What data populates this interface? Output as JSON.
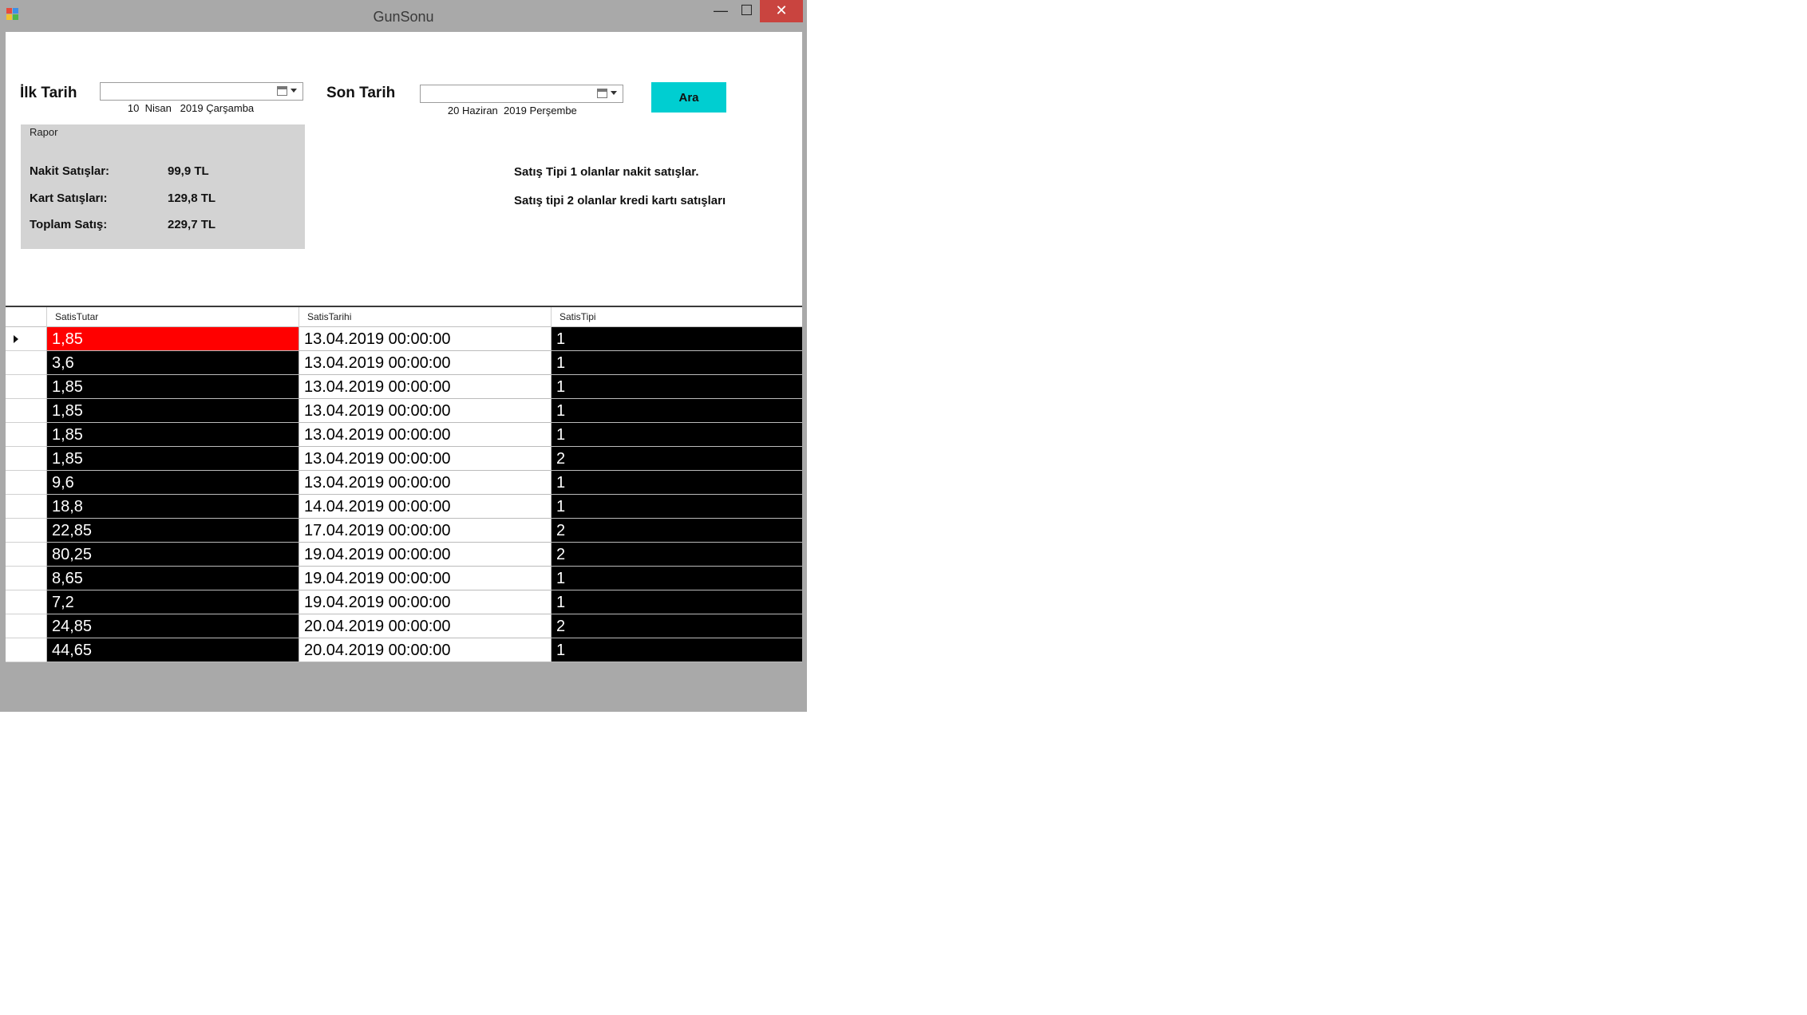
{
  "window": {
    "title": "GunSonu",
    "minimize": "—",
    "maximize": "☐",
    "close": "✕"
  },
  "filters": {
    "start_label": "İlk Tarih",
    "start_value": "10  Nisan   2019 Çarşamba",
    "end_label": "Son Tarih",
    "end_value": "20 Haziran  2019 Perşembe",
    "search_button": "Ara"
  },
  "report": {
    "legend": "Rapor",
    "rows": [
      {
        "label": "Nakit Satışlar:",
        "value": "99,9 TL"
      },
      {
        "label": "Kart Satışları:",
        "value": "129,8 TL"
      },
      {
        "label": "Toplam Satış:",
        "value": "229,7 TL"
      }
    ]
  },
  "notes": [
    "Satış Tipi 1 olanlar nakit satışlar.",
    "Satış tipi 2 olanlar kredi kartı satışları"
  ],
  "grid": {
    "columns": [
      "SatisTutar",
      "SatisTarihi",
      "SatisTipi"
    ],
    "rows": [
      [
        "1,85",
        "13.04.2019 00:00:00",
        "1"
      ],
      [
        "3,6",
        "13.04.2019 00:00:00",
        "1"
      ],
      [
        "1,85",
        "13.04.2019 00:00:00",
        "1"
      ],
      [
        "1,85",
        "13.04.2019 00:00:00",
        "1"
      ],
      [
        "1,85",
        "13.04.2019 00:00:00",
        "1"
      ],
      [
        "1,85",
        "13.04.2019 00:00:00",
        "2"
      ],
      [
        "9,6",
        "13.04.2019 00:00:00",
        "1"
      ],
      [
        "18,8",
        "14.04.2019 00:00:00",
        "1"
      ],
      [
        "22,85",
        "17.04.2019 00:00:00",
        "2"
      ],
      [
        "80,25",
        "19.04.2019 00:00:00",
        "2"
      ],
      [
        "8,65",
        "19.04.2019 00:00:00",
        "1"
      ],
      [
        "7,2",
        "19.04.2019 00:00:00",
        "1"
      ],
      [
        "24,85",
        "20.04.2019 00:00:00",
        "2"
      ],
      [
        "44,65",
        "20.04.2019 00:00:00",
        "1"
      ]
    ],
    "selected_row": 0,
    "colors": {
      "selected_cell_bg": "#ff0000",
      "dark_cell_bg": "#000000",
      "dark_cell_fg": "#ffffff",
      "light_cell_bg": "#ffffff",
      "light_cell_fg": "#000000"
    }
  },
  "colors": {
    "window_bg": "#a9a9a9",
    "search_button": "#00ced1",
    "report_bg": "#d3d3d3",
    "close_button": "#c9443f"
  }
}
